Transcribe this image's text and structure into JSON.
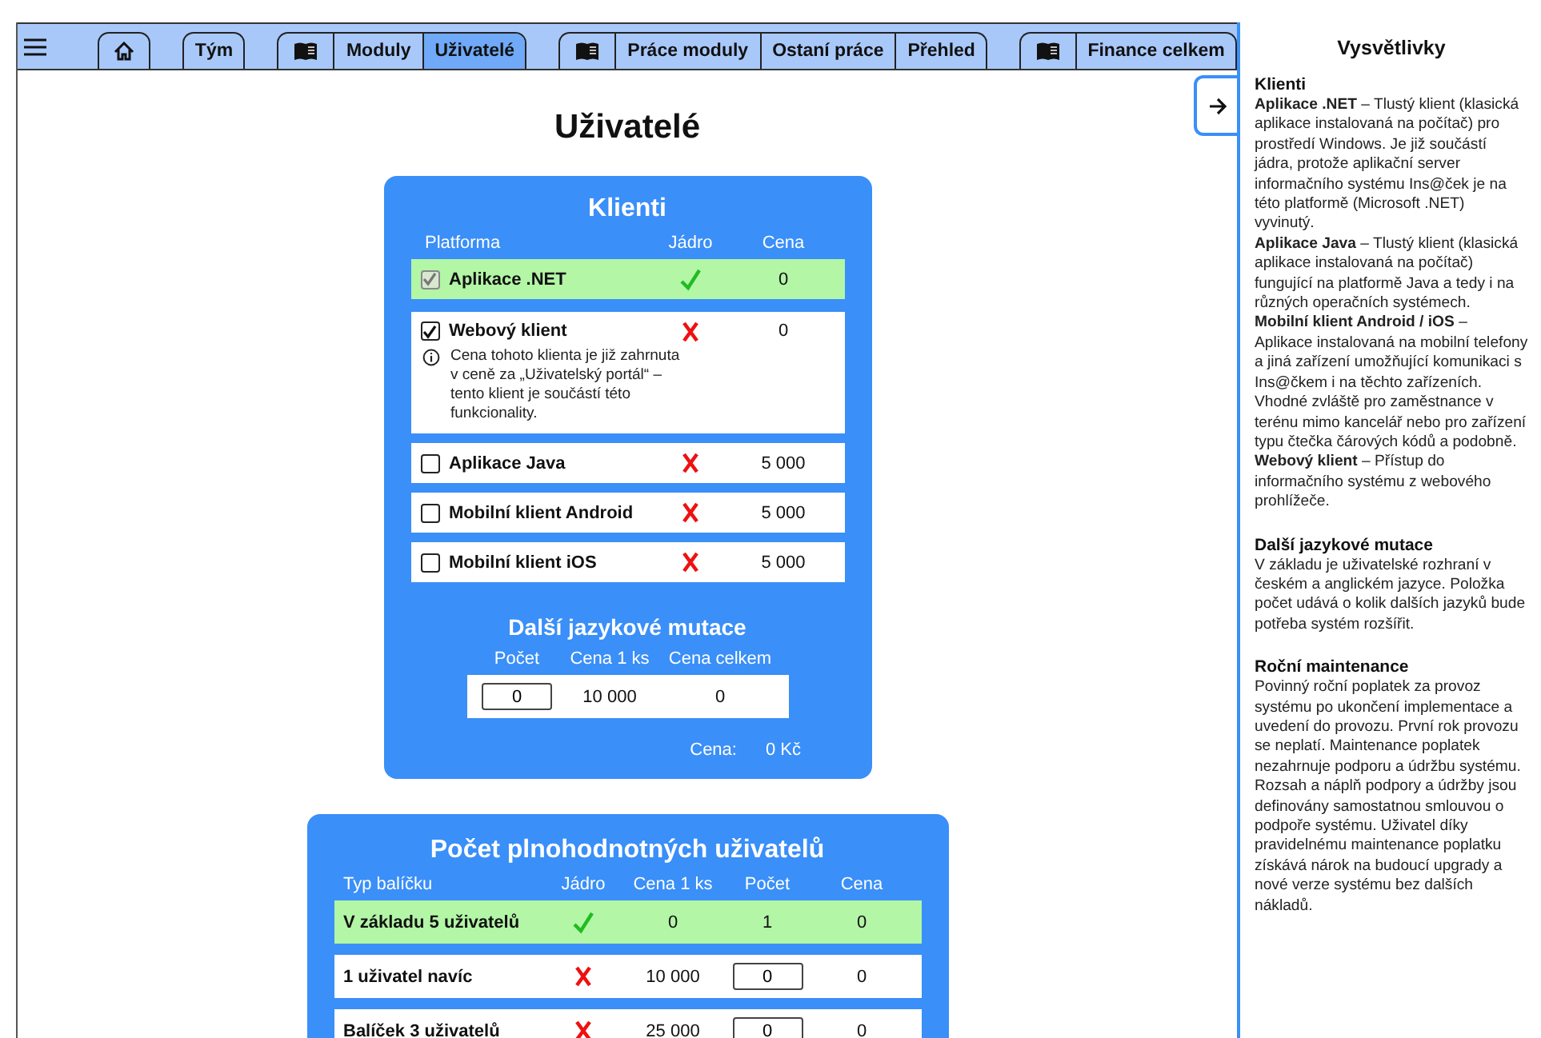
{
  "nav": {
    "groups": [
      {
        "items": [
          {
            "kind": "home",
            "selected": false
          }
        ]
      },
      {
        "items": [
          {
            "kind": "label",
            "label": "Tým",
            "selected": false
          }
        ]
      },
      {
        "items": [
          {
            "kind": "book",
            "selected": false
          },
          {
            "kind": "label",
            "label": "Moduly",
            "selected": false
          },
          {
            "kind": "label",
            "label": "Uživatelé",
            "selected": true
          }
        ]
      },
      {
        "items": [
          {
            "kind": "book",
            "selected": false
          },
          {
            "kind": "label",
            "label": "Práce moduly",
            "selected": false
          },
          {
            "kind": "label",
            "label": "Ostaní práce",
            "selected": false
          },
          {
            "kind": "label",
            "label": "Přehled",
            "selected": false
          }
        ]
      },
      {
        "items": [
          {
            "kind": "book",
            "selected": false
          },
          {
            "kind": "label",
            "label": "Finance celkem",
            "selected": false
          }
        ]
      }
    ]
  },
  "page_title": "Uživatelé",
  "clients": {
    "title": "Klienti",
    "columns": [
      "Platforma",
      "Jádro",
      "Cena"
    ],
    "rows": [
      {
        "name": "Aplikace .NET",
        "checked": true,
        "disabled": true,
        "core": true,
        "price": "0"
      },
      {
        "name": "Webový klient",
        "checked": true,
        "disabled": false,
        "core": false,
        "price": "0",
        "note": "Cena tohoto klienta je již zahrnuta v ceně za „Uživatelský portál“ – tento klient je součástí této funkcionality."
      },
      {
        "name": "Aplikace Java",
        "checked": false,
        "disabled": false,
        "core": false,
        "price": "5 000"
      },
      {
        "name": "Mobilní klient Android",
        "checked": false,
        "disabled": false,
        "core": false,
        "price": "5 000"
      },
      {
        "name": "Mobilní klient iOS",
        "checked": false,
        "disabled": false,
        "core": false,
        "price": "5 000"
      }
    ],
    "languages": {
      "title": "Další jazykové mutace",
      "columns": [
        "Počet",
        "Cena 1 ks",
        "Cena celkem"
      ],
      "count": "0",
      "unit_price": "10 000",
      "total": "0"
    },
    "total_label": "Cena:",
    "total": "0 Kč"
  },
  "users": {
    "title": "Počet plnohodnotných uživatelů",
    "columns": [
      "Typ balíčku",
      "Jádro",
      "Cena 1 ks",
      "Počet",
      "Cena"
    ],
    "rows": [
      {
        "name": "V základu 5 uživatelů",
        "core": true,
        "unit_price": "0",
        "kind": "fixed",
        "count": "1",
        "price": "0"
      },
      {
        "name": "1 uživatel navíc",
        "core": false,
        "unit_price": "10 000",
        "kind": "input",
        "count": "0",
        "price": "0"
      },
      {
        "name": "Balíček 3 uživatelů",
        "core": false,
        "unit_price": "25 000",
        "kind": "input",
        "count": "0",
        "price": "0"
      }
    ]
  },
  "legend": {
    "title": "Vysvětlivky",
    "sections": [
      {
        "heading": "Klienti",
        "paragraphs": [
          "**Aplikace .NET** – Tlustý klient (klasická aplikace instalovaná na počítač) pro prostředí Windows. Je již součástí jádra, protože aplikační server informačního systému Ins@ček je na této platformě (Microsoft .NET) vyvinutý.",
          "**Aplikace Java** – Tlustý klient (klasická aplikace instalovaná na počítač) fungující na platformě Java a tedy i na různých operačních systémech.",
          "**Mobilní klient Android / iOS** – Aplikace instalovaná na mobilní telefony a jiná zařízení umožňující komunikaci s Ins@čkem i na těchto zařízeních. Vhodné zvláště pro zaměstnance v terénu mimo kancelář nebo pro zařízení typu čtečka čárových kódů a podobně.",
          "**Webový klient** – Přístup do informačního systému z webového prohlížeče."
        ]
      },
      {
        "heading": "Další jazykové mutace",
        "paragraphs": [
          "V základu je uživatelské rozhraní v českém a anglickém jazyce. Položka počet udává o kolik dalších jazyků bude potřeba systém rozšířit."
        ]
      },
      {
        "heading": "Roční maintenance",
        "paragraphs": [
          "Povinný roční poplatek za provoz systému po ukončení implementace a uvedení do provozu. První rok provozu se neplatí. Maintenance poplatek nezahrnuje podporu a údržbu systému. Rozsah a náplň podpory a údržby jsou definovány samostatnou smlouvou o podpoře systému. Uživatel díky pravidelnému maintenance poplatku získává nárok na budoucí upgrady a nové verze systému bez dalších nákladů."
        ]
      }
    ]
  }
}
